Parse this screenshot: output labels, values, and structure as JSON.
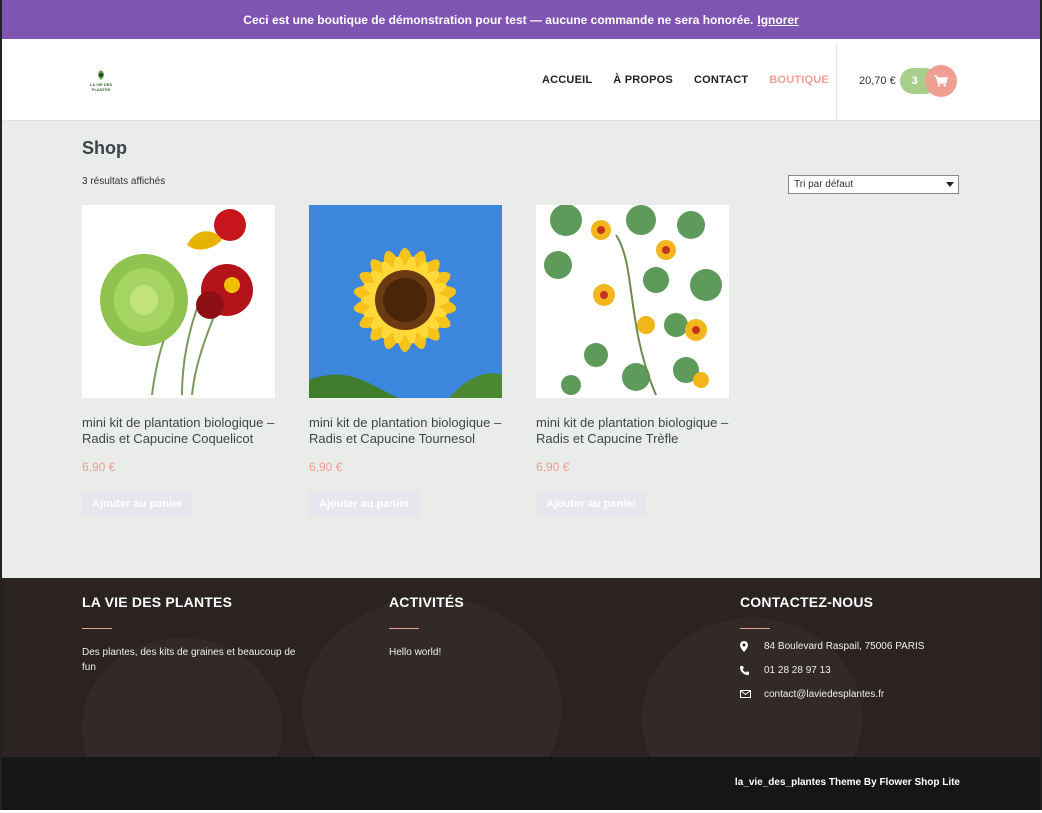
{
  "notice": {
    "text": "Ceci est une boutique de démonstration pour test — aucune commande ne sera honorée.",
    "dismiss": "Ignorer"
  },
  "header": {
    "logo_text": "LA VIE DES PLANTES",
    "nav": [
      "ACCUEIL",
      "À PROPOS",
      "CONTACT",
      "BOUTIQUE"
    ],
    "active_nav": "BOUTIQUE",
    "cart": {
      "total": "20,70 €",
      "count": "3",
      "icon": "cart-icon"
    }
  },
  "shop": {
    "title": "Shop",
    "results": "3 résultats affichés",
    "sort_selected": "Tri par défaut"
  },
  "products": [
    {
      "name": "mini kit de plantation biologique – Radis et Capucine Coquelicot",
      "price": "6,90 €",
      "button": "Ajouter au panier"
    },
    {
      "name": "mini kit de plantation biologique – Radis et Capucine Tournesol",
      "price": "6,90 €",
      "button": "Ajouter au panier"
    },
    {
      "name": "mini kit de plantation biologique – Radis et Capucine Trèfle",
      "price": "6,90 €",
      "button": "Ajouter au panier"
    }
  ],
  "footer": {
    "about": {
      "title": "LA VIE DES PLANTES",
      "text": "Des plantes, des kits de graines et beaucoup de fun"
    },
    "activities": {
      "title": "ACTIVITÉS",
      "link": "Hello world!"
    },
    "contact": {
      "title": "CONTACTEZ-NOUS",
      "address": "84 Boulevard Raspail, 75006 PARIS",
      "phone": "01 28 28 97 13",
      "email": "contact@laviedesplantes.fr"
    },
    "credit": "la_vie_des_plantes Theme By Flower Shop Lite"
  },
  "colors": {
    "notice": "#7f54b3",
    "accent": "#ef9e92",
    "cart_count": "#a8cf8a",
    "footer": "#2a2322"
  }
}
